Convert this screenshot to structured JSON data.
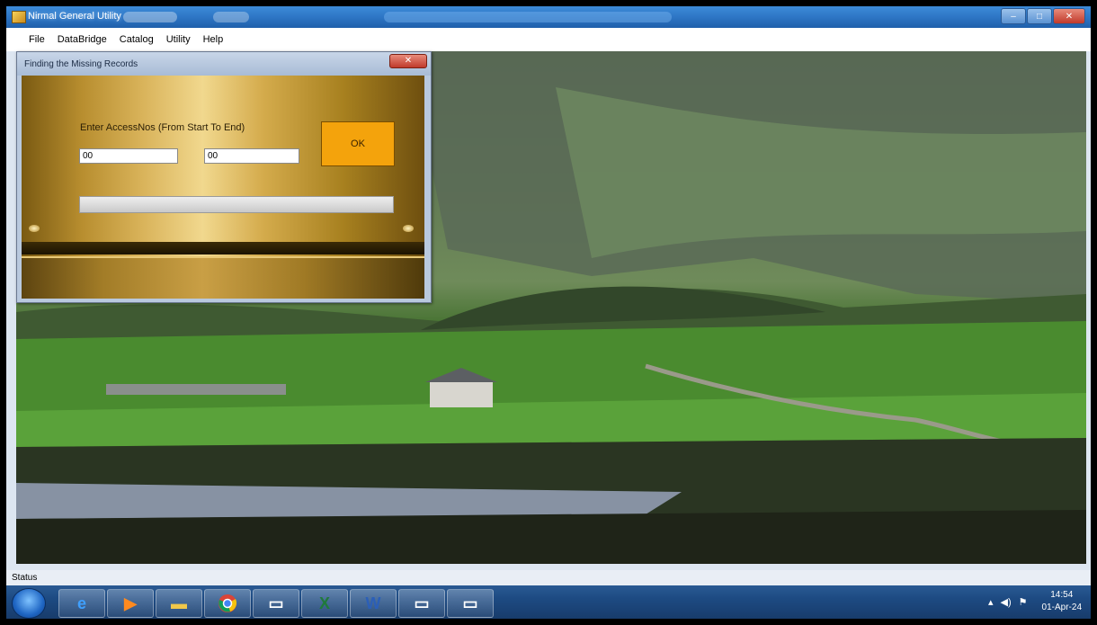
{
  "window": {
    "title": "Nirmal General Utility",
    "minimize": "–",
    "maximize": "□",
    "close": "✕"
  },
  "menu": [
    "File",
    "DataBridge",
    "Catalog",
    "Utility",
    "Help"
  ],
  "dialog": {
    "title": "Finding the Missing Records",
    "close": "✕",
    "label": "Enter AccessNos (From Start To End)",
    "start_value": "00",
    "end_value": "00",
    "ok_label": "OK",
    "progress": 0
  },
  "status": {
    "text": "Status"
  },
  "taskbar": {
    "icons": [
      "start-orb-icon",
      "internet-explorer-icon",
      "media-player-icon",
      "folder-icon",
      "chrome-icon",
      "window-icon",
      "excel-icon",
      "word-icon",
      "window-icon",
      "window-icon"
    ],
    "time": "14:54",
    "date": "01-Apr-24"
  }
}
